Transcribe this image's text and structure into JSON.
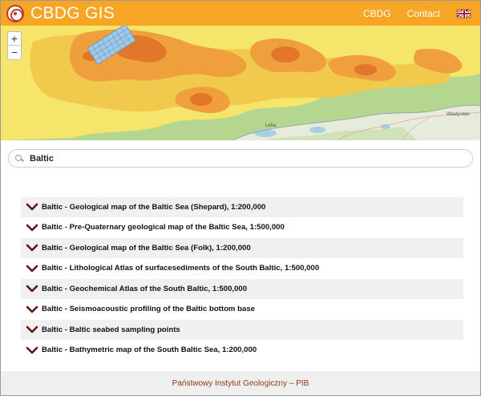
{
  "header": {
    "title": "CBDG GIS",
    "nav": [
      {
        "label": "CBDG"
      },
      {
        "label": "Contact"
      }
    ],
    "language_icon": "uk-flag-icon",
    "background_color": "#f6a623"
  },
  "map": {
    "zoom_in_label": "+",
    "zoom_out_label": "−",
    "place_labels": [
      "Łeba",
      "Władysław"
    ]
  },
  "search": {
    "value": "Baltic",
    "icon": "search-icon"
  },
  "results": [
    {
      "label": "Baltic - Geological map of the Baltic Sea (Shepard), 1:200,000"
    },
    {
      "label": "Baltic - Pre-Quaternary geological map of the Baltic Sea, 1:500,000"
    },
    {
      "label": "Baltic - Geological map of the Baltic Sea (Folk), 1:200,000"
    },
    {
      "label": "Baltic - Lithological Atlas of surfacesediments of the South Baltic, 1:500,000"
    },
    {
      "label": "Baltic - Geochemical Atlas of the South Baltic, 1:500,000"
    },
    {
      "label": "Baltic - Seismoacoustic profiling of the Baltic bottom base"
    },
    {
      "label": "Baltic - Baltic seabed sampling points"
    },
    {
      "label": "Baltic - Bathymetric map of the South Baltic Sea, 1:200,000"
    }
  ],
  "footer": {
    "text": "Państwowy Instytut Geologiczny – PIB"
  },
  "colors": {
    "chevron": "#5a1a0a",
    "footer_text": "#8a3b1a"
  }
}
